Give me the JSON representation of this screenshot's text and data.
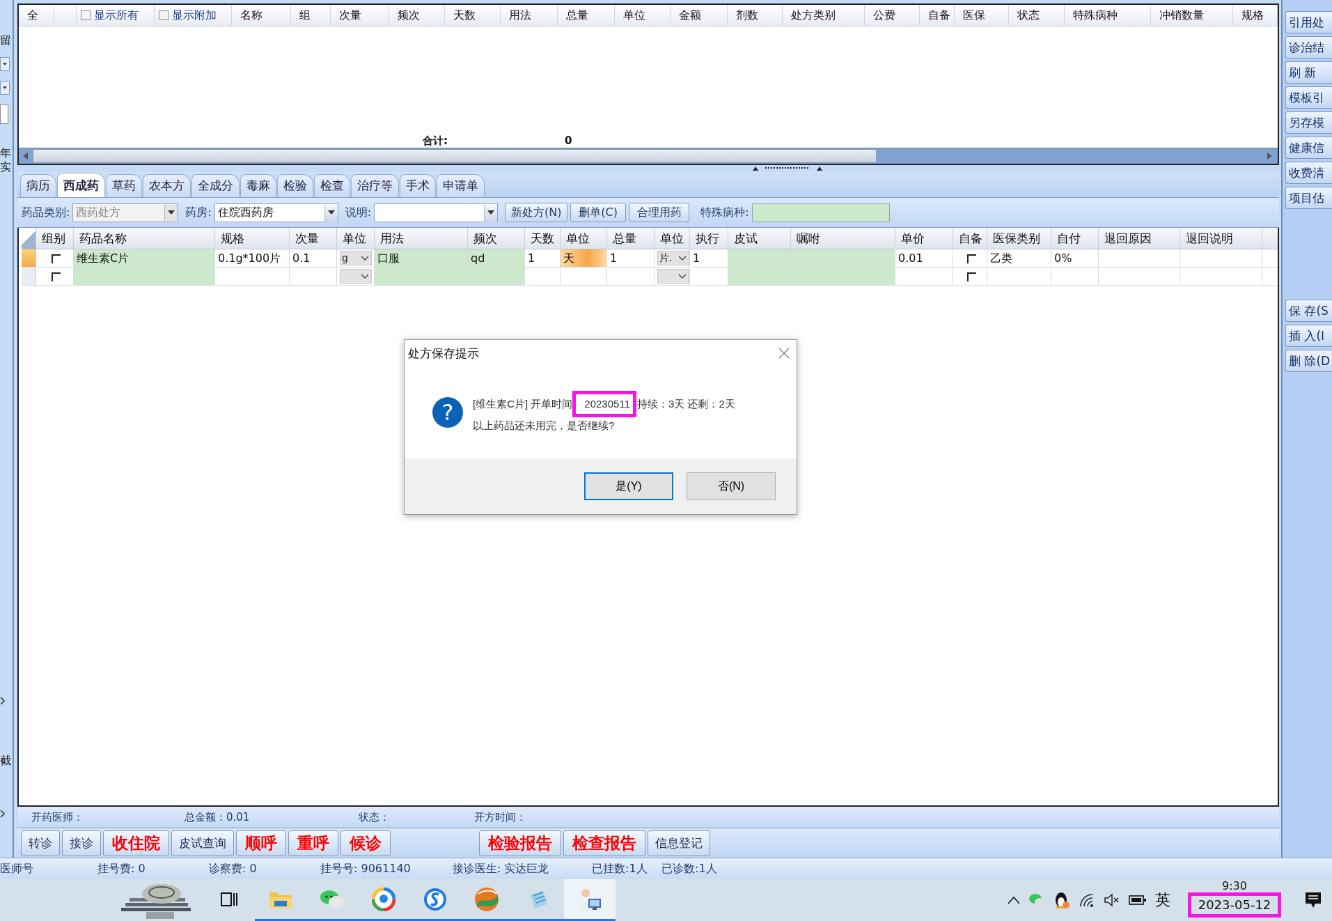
{
  "left_strip": {
    "labels": [
      "留",
      "年",
      "实",
      "截"
    ]
  },
  "top_grid": {
    "columns": [
      {
        "kind": "text",
        "label": "全"
      },
      {
        "kind": "spacer"
      },
      {
        "kind": "checkbox",
        "label": "显示所有",
        "checked": false
      },
      {
        "kind": "checkbox",
        "label": "显示附加",
        "checked": false
      },
      {
        "kind": "text",
        "label": "名称"
      },
      {
        "kind": "text",
        "label": "组"
      },
      {
        "kind": "text",
        "label": "次量"
      },
      {
        "kind": "text",
        "label": "频次"
      },
      {
        "kind": "text",
        "label": "天数"
      },
      {
        "kind": "text",
        "label": "用法"
      },
      {
        "kind": "text",
        "label": "总量"
      },
      {
        "kind": "text",
        "label": "单位"
      },
      {
        "kind": "text",
        "label": "金额"
      },
      {
        "kind": "text",
        "label": "剂数"
      },
      {
        "kind": "text",
        "label": "处方类别"
      },
      {
        "kind": "text",
        "label": "公费"
      },
      {
        "kind": "text",
        "label": "自备"
      },
      {
        "kind": "text",
        "label": "医保"
      },
      {
        "kind": "text",
        "label": "状态"
      },
      {
        "kind": "text",
        "label": "特殊病种"
      },
      {
        "kind": "text",
        "label": "冲销数量"
      },
      {
        "kind": "text",
        "label": "规格"
      }
    ],
    "total_label": "合计:",
    "total_value": "0"
  },
  "tabs": [
    {
      "label": "病历",
      "selected": false
    },
    {
      "label": "西成药",
      "selected": true
    },
    {
      "label": "草药",
      "selected": false
    },
    {
      "label": "农本方",
      "selected": false
    },
    {
      "label": "全成分",
      "selected": false
    },
    {
      "label": "毒麻",
      "selected": false
    },
    {
      "label": "检验",
      "selected": false
    },
    {
      "label": "检查",
      "selected": false
    },
    {
      "label": "治疗等",
      "selected": false
    },
    {
      "label": "手术",
      "selected": false
    },
    {
      "label": "申请单",
      "selected": false
    }
  ],
  "toolbar": {
    "category": {
      "label": "药品类别:",
      "value": "西药处方",
      "disabled": true
    },
    "pharmacy": {
      "label": "药房:",
      "value": "住院西药房",
      "disabled": false
    },
    "note": {
      "label": "说明:",
      "disabled": false
    },
    "buttons": [
      "新处方(N)",
      "删单(C)",
      "合理用药"
    ],
    "special": {
      "label": "特殊病种:"
    }
  },
  "drug_grid": {
    "columns": [
      {
        "label": "组别",
        "editable": false
      },
      {
        "label": "药品名称",
        "editable": true
      },
      {
        "label": "规格",
        "editable": false
      },
      {
        "label": "次量",
        "editable": false
      },
      {
        "label": "单位",
        "editable": false
      },
      {
        "label": "用法",
        "editable": true
      },
      {
        "label": "频次",
        "editable": true
      },
      {
        "label": "天数",
        "editable": false
      },
      {
        "label": "单位",
        "editable": false
      },
      {
        "label": "总量",
        "editable": false
      },
      {
        "label": "单位",
        "editable": false
      },
      {
        "label": "执行",
        "editable": false
      },
      {
        "label": "皮试",
        "editable": true
      },
      {
        "label": "嘱咐",
        "editable": true
      },
      {
        "label": "单价",
        "editable": false
      },
      {
        "label": "自备",
        "editable": false
      },
      {
        "label": "医保类别",
        "editable": false
      },
      {
        "label": "自付",
        "editable": false
      },
      {
        "label": "退回原因",
        "editable": false
      },
      {
        "label": "退回说明",
        "editable": false
      }
    ],
    "rows": [
      {
        "current": true,
        "cells": [
          {
            "kind": "check",
            "checked": false,
            "selected": false
          },
          {
            "kind": "text",
            "value": "维生素C片",
            "selected": false
          },
          {
            "kind": "text",
            "value": "0.1g*100片",
            "selected": false
          },
          {
            "kind": "text",
            "value": "0.1",
            "selected": false
          },
          {
            "kind": "combo",
            "value": "g",
            "selected": false
          },
          {
            "kind": "text",
            "value": "口服",
            "selected": false
          },
          {
            "kind": "text",
            "value": "qd",
            "selected": false
          },
          {
            "kind": "text",
            "value": "1",
            "selected": false
          },
          {
            "kind": "text",
            "value": "天",
            "selected": true
          },
          {
            "kind": "text",
            "value": "1",
            "selected": false
          },
          {
            "kind": "combo",
            "value": "片.",
            "selected": false
          },
          {
            "kind": "text",
            "value": "1",
            "selected": false
          },
          {
            "kind": "text",
            "selected": false
          },
          {
            "kind": "text",
            "selected": false
          },
          {
            "kind": "text",
            "value": "0.01",
            "selected": false
          },
          {
            "kind": "check",
            "checked": false,
            "selected": false
          },
          {
            "kind": "text",
            "value": "乙类",
            "selected": false
          },
          {
            "kind": "text",
            "value": "0%",
            "selected": false
          },
          {
            "kind": "text",
            "selected": false
          },
          {
            "kind": "text",
            "selected": false
          }
        ]
      },
      {
        "current": false,
        "cells": [
          {
            "kind": "check",
            "checked": false,
            "selected": false
          },
          {
            "kind": "text",
            "selected": false
          },
          {
            "kind": "text",
            "selected": false
          },
          {
            "kind": "text",
            "selected": false
          },
          {
            "kind": "combo",
            "selected": false
          },
          {
            "kind": "text",
            "selected": false
          },
          {
            "kind": "text",
            "selected": false
          },
          {
            "kind": "text",
            "selected": false
          },
          {
            "kind": "text",
            "selected": false
          },
          {
            "kind": "text",
            "selected": false
          },
          {
            "kind": "combo",
            "selected": false
          },
          {
            "kind": "text",
            "selected": false
          },
          {
            "kind": "text",
            "selected": false
          },
          {
            "kind": "text",
            "selected": false
          },
          {
            "kind": "text",
            "selected": false
          },
          {
            "kind": "check",
            "checked": false,
            "selected": false
          },
          {
            "kind": "text",
            "selected": false
          },
          {
            "kind": "text",
            "selected": false
          },
          {
            "kind": "text",
            "selected": false
          },
          {
            "kind": "text",
            "selected": false
          }
        ]
      }
    ]
  },
  "dialog": {
    "title": "处方保存提示",
    "icon_glyph": "?",
    "message_before": "[维生素C片] 开单时间",
    "message_highlight": "20230511",
    "message_after": "持续：3天 还剩：2天",
    "message_line2": "以上药品还未用完，是否继续?",
    "buttons": [
      {
        "label": "是(Y)",
        "focused": true
      },
      {
        "label": "否(N)",
        "focused": false
      }
    ]
  },
  "right_bar": {
    "top": [
      "引用处",
      "诊治结",
      "刷 新",
      "模板引",
      "另存模",
      "健康信",
      "收费清",
      "项目估"
    ],
    "bottom": [
      "保 存(S",
      "插 入(I",
      "删 除(D"
    ]
  },
  "info_bar": [
    "开药医师：",
    "总金额：0.01",
    "状态：",
    "开方时间："
  ],
  "action_buttons": [
    {
      "label": "转诊",
      "kind": "normal"
    },
    {
      "label": "接诊",
      "kind": "normal"
    },
    {
      "label": "收住院",
      "kind": "alert"
    },
    {
      "label": "皮试查询",
      "kind": "normal"
    },
    {
      "label": "顺呼",
      "kind": "alert"
    },
    {
      "label": "重呼",
      "kind": "alert"
    },
    {
      "label": "候诊",
      "kind": "alert"
    },
    {
      "label": "检验报告",
      "kind": "alert"
    },
    {
      "label": "检查报告",
      "kind": "alert"
    },
    {
      "label": "信息登记",
      "kind": "normal"
    }
  ],
  "status_bar": [
    "医师号",
    "挂号费:  0",
    "诊察费: 0",
    "挂号号:  9061140",
    "接诊医生:  实达巨龙",
    "已挂数:1人",
    "已诊数:1人"
  ],
  "taskbar": {
    "apps": [
      {
        "kind": "blocks",
        "running": false,
        "active": false
      },
      {
        "kind": "taskview",
        "running": false,
        "active": false
      },
      {
        "kind": "folder",
        "running": true,
        "active": false
      },
      {
        "kind": "chat",
        "running": true,
        "active": false
      },
      {
        "kind": "ring",
        "running": true,
        "active": false
      },
      {
        "kind": "wave",
        "running": true,
        "active": false
      },
      {
        "kind": "orb",
        "running": true,
        "active": false
      },
      {
        "kind": "notepad",
        "running": true,
        "active": false
      },
      {
        "kind": "doctor",
        "running": true,
        "active": true
      }
    ],
    "tray": [
      {
        "kind": "chevron"
      },
      {
        "kind": "chat"
      },
      {
        "kind": "penguin"
      },
      {
        "kind": "wifi"
      },
      {
        "kind": "mute"
      },
      {
        "kind": "battery"
      }
    ],
    "ime": "英",
    "time": "9:30",
    "date": "2023-05-12"
  }
}
